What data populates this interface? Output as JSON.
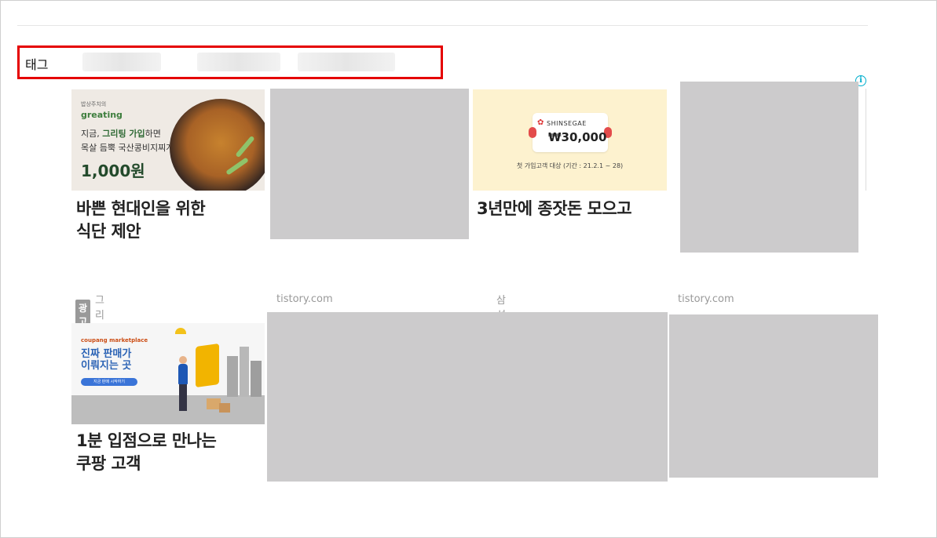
{
  "tags": {
    "label": "태그"
  },
  "ads_row1": [
    {
      "title": "바쁜 현대인을 위한 식단 제안",
      "title_lines": [
        "바쁜 현대인을 위한",
        "식단 제안"
      ],
      "image": {
        "small": "밥상주치의",
        "brand": "greating",
        "line1_pre": "지금, ",
        "line1_bold": "그리팅 가입",
        "line1_post": "하면",
        "line2": "목살 듬뿍 국산콩비지찌개",
        "price": "1,000원"
      },
      "badge": "광고",
      "source": "그리팅"
    },
    {
      "title": "",
      "source": "tistory.com"
    },
    {
      "title": "3년만에 종잣돈 모으고",
      "image": {
        "brand": "SHINSEGAE",
        "amount": "₩30,000",
        "sub": "첫 가입고객 대상 (기간 : 21.2.1 ~ 28)"
      },
      "badge": "광고",
      "source": "삼성 인터넷 저축보험"
    },
    {
      "title": "",
      "source": "tistory.com"
    }
  ],
  "ads_row2": [
    {
      "title": "1분 입점으로 만나는 쿠팡 고객",
      "title_lines": [
        "1분 입점으로 만나는",
        "쿠팡 고객"
      ],
      "image": {
        "brand": "coupang marketplace",
        "headline_lines": [
          "진짜 판매가",
          "이뤄지는 곳"
        ],
        "button": "지금 판매 시작하기"
      }
    }
  ],
  "info_icon": "i"
}
